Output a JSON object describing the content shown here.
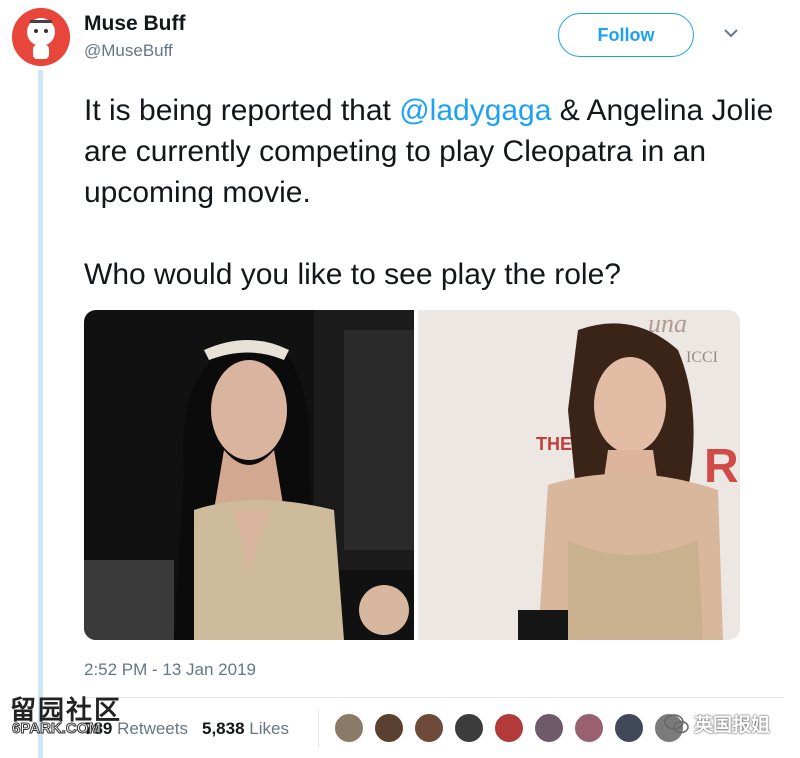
{
  "author": {
    "display_name": "Muse Buff",
    "handle": "@MuseBuff",
    "avatar_icon": "stick-figure-avatar-icon"
  },
  "actions": {
    "follow_label": "Follow",
    "more_icon": "chevron-down-icon"
  },
  "tweet": {
    "text_before_mention": "It is being reported that ",
    "mention": "@ladygaga",
    "text_after_mention": " & Angelina Jolie are currently competing to play Cleopatra in an upcoming movie.",
    "question": "Who would you like to see play the role?",
    "mention_color": "#1da1f2"
  },
  "media": {
    "photos": [
      {
        "name": "photo-lady-gaga",
        "backdrop_text": ""
      },
      {
        "name": "photo-angelina-jolie",
        "backdrop_text": [
          "una",
          "ICCI",
          "THE",
          "RI"
        ]
      }
    ]
  },
  "meta": {
    "timestamp": "2:52 PM - 13 Jan 2019"
  },
  "stats": {
    "retweets_count": "789",
    "retweets_label": "Retweets",
    "likes_count": "5,838",
    "likes_label": "Likes",
    "liker_avatar_colors": [
      "#8a7a68",
      "#5a4030",
      "#6d4a3a",
      "#3c3c3c",
      "#b23a3a",
      "#6f5a6a",
      "#9a6070",
      "#40485a",
      "#7b7b7b"
    ]
  },
  "watermarks": {
    "left_chars": "留园社区",
    "left_sub": "6PARK.COM",
    "right_text": "英国报姐",
    "right_icon": "wechat-icon"
  },
  "colors": {
    "accent": "#1da1f2",
    "text_primary": "#14171a",
    "text_secondary": "#657786"
  }
}
